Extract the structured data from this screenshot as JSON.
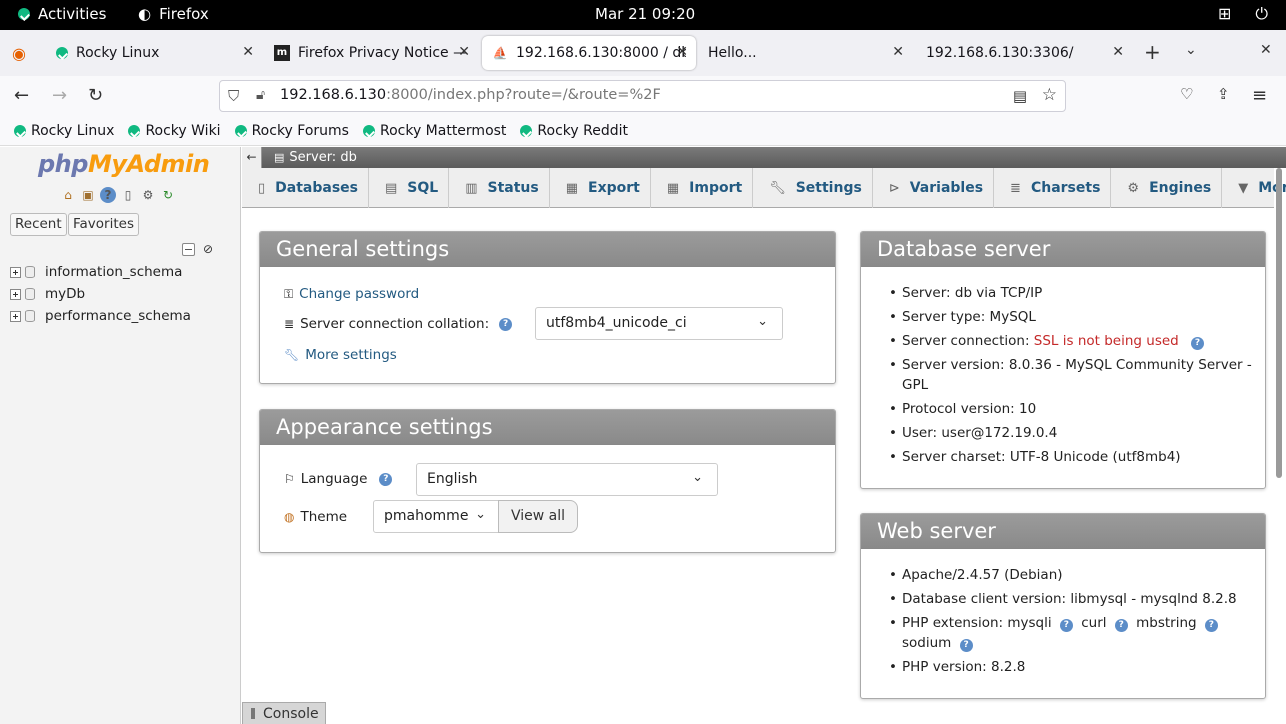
{
  "gnome": {
    "activities": "Activities",
    "app": "Firefox",
    "clock": "Mar 21  09:20"
  },
  "tabs": [
    {
      "title": "Rocky Linux"
    },
    {
      "title": "Firefox Privacy Notice —"
    },
    {
      "title": "192.168.6.130:8000 / db"
    },
    {
      "title": "Hello..."
    },
    {
      "title": "192.168.6.130:3306/"
    }
  ],
  "url": {
    "host": "192.168.6.130",
    "rest": ":8000/index.php?route=/&route=%2F"
  },
  "bookmarks": [
    "Rocky Linux",
    "Rocky Wiki",
    "Rocky Forums",
    "Rocky Mattermost",
    "Rocky Reddit"
  ],
  "nav": {
    "logo_php": "php",
    "logo_ma": "MyAdmin",
    "recent": "Recent",
    "favorites": "Favorites",
    "databases": [
      "information_schema",
      "myDb",
      "performance_schema"
    ]
  },
  "server": {
    "title": "Server: db"
  },
  "menu": [
    "Databases",
    "SQL",
    "Status",
    "Export",
    "Import",
    "Settings",
    "Variables",
    "Charsets",
    "Engines",
    "More"
  ],
  "general": {
    "title": "General settings",
    "change_password": "Change password",
    "collation_label": "Server connection collation:",
    "collation_value": "utf8mb4_unicode_ci",
    "more_settings": "More settings"
  },
  "appearance": {
    "title": "Appearance settings",
    "language_label": "Language",
    "language_value": "English",
    "theme_label": "Theme",
    "theme_value": "pmahomme",
    "view_all": "View all"
  },
  "dbserver": {
    "title": "Database server",
    "server": "Server: db via TCP/IP",
    "type": "Server type: MySQL",
    "conn_label": "Server connection: ",
    "conn_value": "SSL is not being used",
    "version": "Server version: 8.0.36 - MySQL Community Server - GPL",
    "protocol": "Protocol version: 10",
    "user": "User: user@172.19.0.4",
    "charset": "Server charset: UTF-8 Unicode (utf8mb4)"
  },
  "webserver": {
    "title": "Web server",
    "apache": "Apache/2.4.57 (Debian)",
    "client": "Database client version: libmysql - mysqlnd 8.2.8",
    "ext_label": "PHP extension: mysqli",
    "ext_curl": "curl",
    "ext_mbstring": "mbstring",
    "ext_sodium": "sodium",
    "php_version": "PHP version: 8.2.8"
  },
  "console": "Console"
}
